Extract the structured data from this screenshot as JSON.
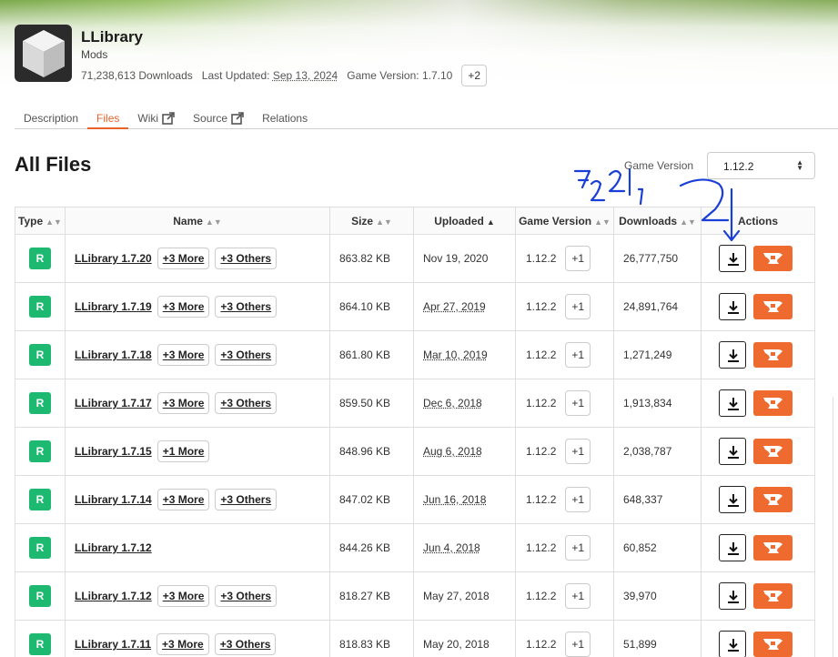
{
  "mod": {
    "title": "LLibrary",
    "category": "Mods",
    "downloads": "71,238,613 Downloads",
    "last_updated_label": "Last Updated:",
    "last_updated": "Sep 13, 2024",
    "game_version_label": "Game Version:",
    "game_version": "1.7.10",
    "extra_versions": "+2",
    "logo_icon": "cube-icon"
  },
  "tabs": [
    {
      "label": "Description"
    },
    {
      "label": "Files"
    },
    {
      "label": "Wiki"
    },
    {
      "label": "Source"
    },
    {
      "label": "Relations"
    }
  ],
  "page_title": "All Files",
  "filter": {
    "label": "Game Version",
    "value": "1.12.2"
  },
  "table": {
    "headers": {
      "type": "Type",
      "name": "Name",
      "size": "Size",
      "uploaded": "Uploaded",
      "game_version": "Game Version",
      "downloads": "Downloads",
      "actions": "Actions"
    },
    "rows": [
      {
        "type": "R",
        "name": "LLibrary 1.7.20",
        "more": "+3 More",
        "others": "+3 Others",
        "size": "863.82 KB",
        "uploaded": "Nov 19, 2020",
        "game_version": "1.12.2",
        "gv_more": "+1",
        "downloads": "26,777,750"
      },
      {
        "type": "R",
        "name": "LLibrary 1.7.19",
        "more": "+3 More",
        "others": "+3 Others",
        "size": "864.10 KB",
        "uploaded": "Apr 27, 2019",
        "game_version": "1.12.2",
        "gv_more": "+1",
        "downloads": "24,891,764"
      },
      {
        "type": "R",
        "name": "LLibrary 1.7.18",
        "more": "+3 More",
        "others": "+3 Others",
        "size": "861.80 KB",
        "uploaded": "Mar 10, 2019",
        "game_version": "1.12.2",
        "gv_more": "+1",
        "downloads": "1,271,249"
      },
      {
        "type": "R",
        "name": "LLibrary 1.7.17",
        "more": "+3 More",
        "others": "+3 Others",
        "size": "859.50 KB",
        "uploaded": "Dec 6, 2018",
        "game_version": "1.12.2",
        "gv_more": "+1",
        "downloads": "1,913,834"
      },
      {
        "type": "R",
        "name": "LLibrary 1.7.15",
        "more": "+1 More",
        "others": "",
        "size": "848.96 KB",
        "uploaded": "Aug 6, 2018",
        "game_version": "1.12.2",
        "gv_more": "+1",
        "downloads": "2,038,787"
      },
      {
        "type": "R",
        "name": "LLibrary 1.7.14",
        "more": "+3 More",
        "others": "+3 Others",
        "size": "847.02 KB",
        "uploaded": "Jun 16, 2018",
        "game_version": "1.12.2",
        "gv_more": "+1",
        "downloads": "648,337"
      },
      {
        "type": "R",
        "name": "LLibrary 1.7.12",
        "more": "",
        "others": "",
        "size": "844.26 KB",
        "uploaded": "Jun 4, 2018",
        "game_version": "1.12.2",
        "gv_more": "+1",
        "downloads": "60,852"
      },
      {
        "type": "R",
        "name": "LLibrary 1.7.12",
        "more": "+3 More",
        "others": "+3 Others",
        "size": "818.27 KB",
        "uploaded": "May 27, 2018",
        "game_version": "1.12.2",
        "gv_more": "+1",
        "downloads": "39,970"
      },
      {
        "type": "R",
        "name": "LLibrary 1.7.11",
        "more": "+3 More",
        "others": "+3 Others",
        "size": "818.83 KB",
        "uploaded": "May 20, 2018",
        "game_version": "1.12.2",
        "gv_more": "+1",
        "downloads": "51,899"
      }
    ]
  },
  "accent_color": "#e8632c",
  "badge_color": "#1db970",
  "annotation_color": "#1a3fd6"
}
